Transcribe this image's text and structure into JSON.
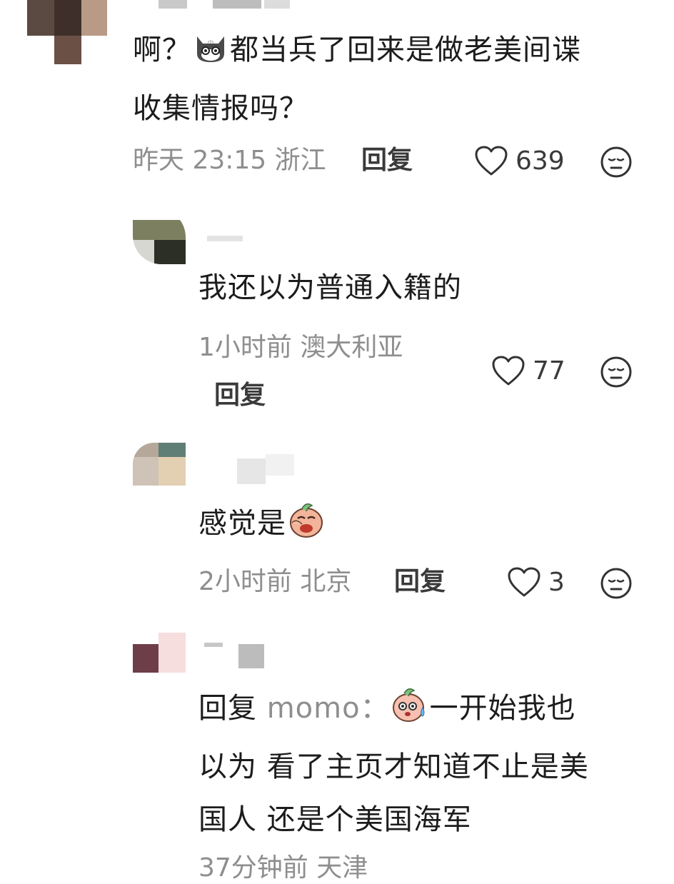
{
  "comments": [
    {
      "text_before": "啊？",
      "emoji_1": "cat-emoji",
      "text_after_line1": "都当兵了回来是做老美间谍",
      "text_line2": "收集情报吗？",
      "time": "昨天 23:15",
      "location": "浙江",
      "reply_label": "回复",
      "likes": "639"
    },
    {
      "text": "我还以为普通入籍的",
      "time": "1小时前",
      "location": "澳大利亚",
      "reply_label": "回复",
      "likes": "77"
    },
    {
      "text": "感觉是",
      "emoji_1": "facepalm-peach-emoji",
      "time": "2小时前",
      "location": "北京",
      "reply_label": "回复",
      "likes": "3"
    },
    {
      "reply_prefix": "回复",
      "reply_to": "momo：",
      "emoji_1": "sweat-peach-emoji",
      "text_line1": "一开始我也",
      "text_line2": "以为 看了主页才知道不止是美",
      "text_line3": "国人 还是个美国海军",
      "time_partial": "37分钟前 天津"
    }
  ],
  "colors": {
    "text": "#1c1c1c",
    "meta": "#8e8e8e",
    "reply": "#3a3a3a"
  }
}
